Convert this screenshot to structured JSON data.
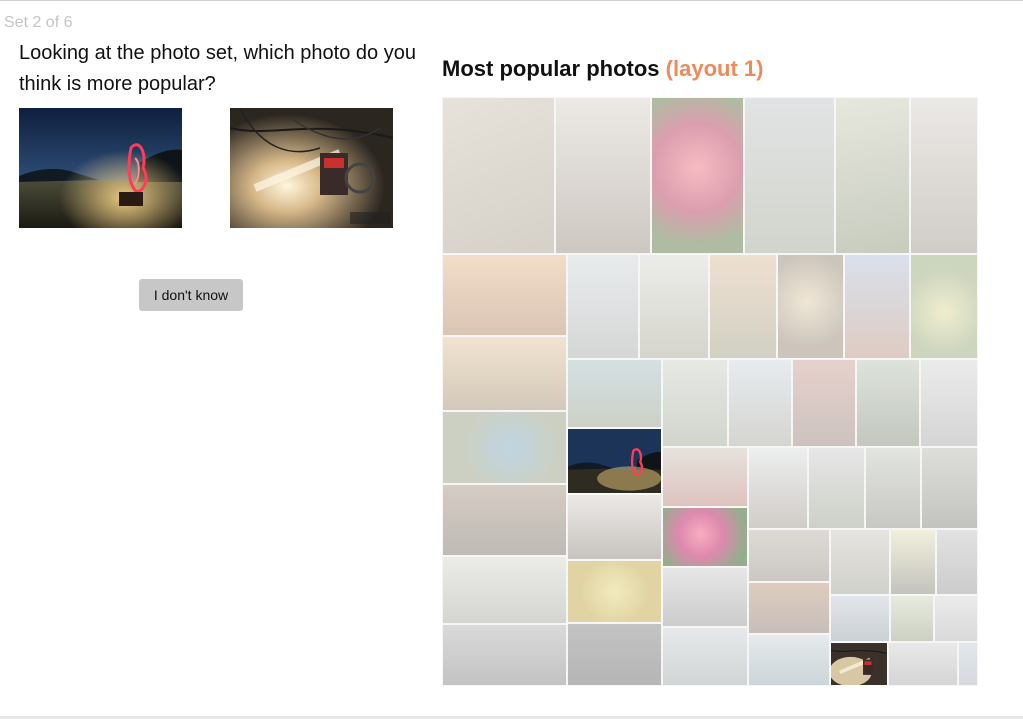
{
  "header": {
    "set_counter": "Set 2 of 6"
  },
  "question": {
    "text": "Looking at the photo set, which photo do you think is more popular?"
  },
  "choices": [
    {
      "id": "a",
      "description": "night beach light painting photo"
    },
    {
      "id": "b",
      "description": "workshop light and wires photo",
      "watermark": "Wonderdesign"
    }
  ],
  "actions": {
    "dont_know_label": "I don't know"
  },
  "mosaic": {
    "title": "Most popular photos",
    "layout_label": "(layout 1)",
    "accent_color": "#ef8a5c"
  }
}
